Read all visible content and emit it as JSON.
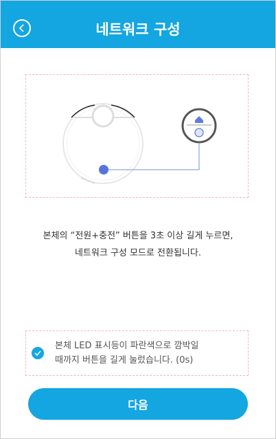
{
  "header": {
    "title": "네트워크 구성",
    "back_icon": "chevron-left-circle-icon"
  },
  "instruction": {
    "line1": "본체의 “전원+충전” 버튼을 3초 이상 길게 누르면,",
    "line2": "네트워크 구성 모드로 전환됩니다."
  },
  "confirm": {
    "checked": true,
    "line1": "본체 LED 표시등이 파란색으로 깜박일",
    "line2": "때까지 버튼을 길게 눌렀습니다. (0s)"
  },
  "next_button": {
    "label": "다음"
  },
  "colors": {
    "accent": "#14a6e0",
    "highlight": "#3b5bd6"
  }
}
